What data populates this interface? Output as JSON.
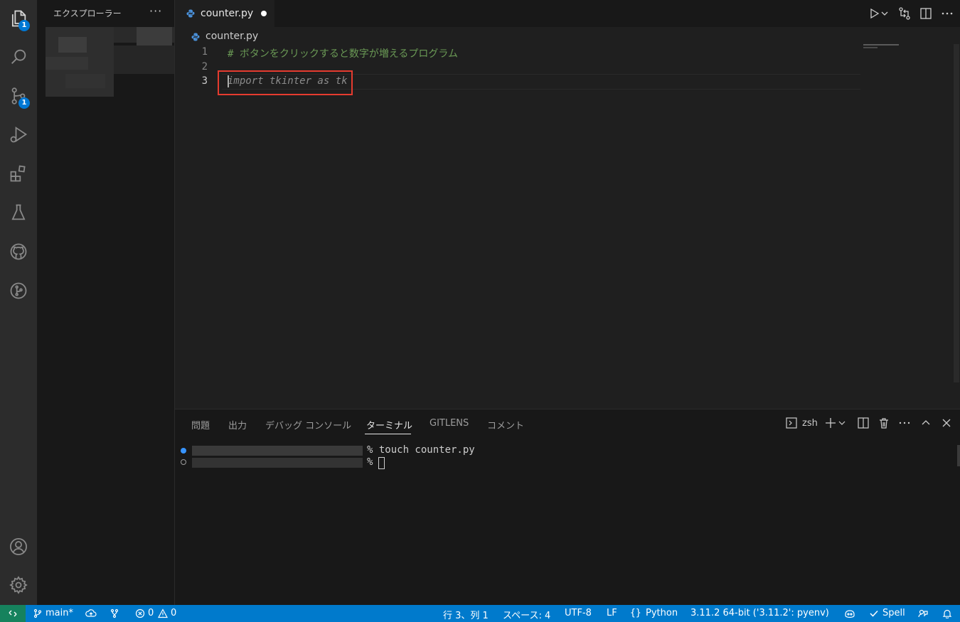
{
  "sidebar": {
    "title": "エクスプローラー",
    "more": "···"
  },
  "activity": {
    "explorer_badge": "1",
    "scm_badge": "1"
  },
  "editor": {
    "tab_label": "counter.py",
    "breadcrumb": "counter.py",
    "lines": [
      {
        "number": "1",
        "text": "# ボタンをクリックすると数字が増えるプログラム"
      },
      {
        "number": "2",
        "text": ""
      },
      {
        "number": "3",
        "text": "import tkinter as tk"
      }
    ]
  },
  "panel": {
    "tabs": [
      "問題",
      "出力",
      "デバッグ コンソール",
      "ターミナル",
      "GITLENS",
      "コメント"
    ],
    "active_tab": "ターミナル",
    "shell": "zsh",
    "terminal_lines": [
      "% touch counter.py",
      "% "
    ]
  },
  "statusbar": {
    "branch": "main*",
    "errors": "0",
    "warnings": "0",
    "position": "行 3、列 1",
    "spaces": "スペース: 4",
    "encoding": "UTF-8",
    "eol": "LF",
    "language": "Python",
    "interpreter": "3.11.2 64-bit ('3.11.2': pyenv)",
    "spell": "Spell"
  },
  "colors": {
    "accent": "#007acc",
    "comment": "#6a9955",
    "ghost_text": "#8b8b8b",
    "highlight_box": "#e53b2f",
    "remote": "#16825d"
  }
}
